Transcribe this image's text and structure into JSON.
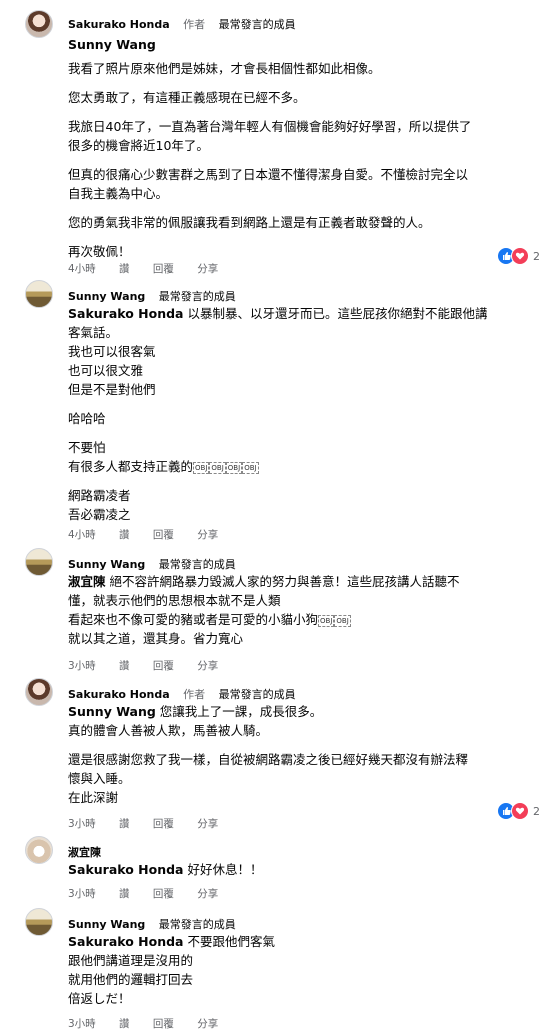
{
  "comments": [
    {
      "author": "Sakurako Honda",
      "badge_author": "作者",
      "badge_member": "最常發言的成員",
      "lines": [
        {
          "text": "Sunny Wang",
          "mention": true
        },
        {
          "text": "我看了照片原來他們是姊妹，才會長相個性都如此相像。"
        },
        {
          "text": "",
          "gap": true
        },
        {
          "text": "您太勇敢了，有這種正義感現在已經不多。"
        },
        {
          "text": "",
          "gap": true
        },
        {
          "text": "我旅日40年了，一直為著台灣年輕人有個機會能夠好好學習，所以提供了"
        },
        {
          "text": "很多的機會將近10年了。"
        },
        {
          "text": "",
          "gap": true
        },
        {
          "text": "但真的很痛心少數害群之馬到了日本還不懂得潔身自愛。不懂檢討完全以"
        },
        {
          "text": "自我主義為中心。"
        },
        {
          "text": "",
          "gap": true
        },
        {
          "text": "您的勇氣我非常的佩服讓我看到網路上還是有正義者敢發聲的人。"
        },
        {
          "text": "",
          "gap": true
        },
        {
          "text": "再次敬佩！"
        }
      ],
      "time": "4小時",
      "actions": [
        "讚",
        "回覆",
        "分享"
      ],
      "reaction_count": "2"
    },
    {
      "author": "Sunny Wang",
      "badge_member": "最常發言的成員",
      "lines": [
        {
          "mention_prefix": "Sakurako Honda",
          "text": " 以暴制暴、以牙還牙而已。這些屁孩你絕對不能跟他講"
        },
        {
          "text": "客氣話。"
        },
        {
          "text": "我也可以很客氣"
        },
        {
          "text": "也可以很文雅"
        },
        {
          "text": "但是不是對他們"
        },
        {
          "text": "",
          "gap": true
        },
        {
          "text": "哈哈哈"
        },
        {
          "text": "",
          "gap": true
        },
        {
          "text": "不要怕"
        },
        {
          "text": "有很多人都支持正義的",
          "emoji_count": 4
        },
        {
          "text": "",
          "gap": true
        },
        {
          "text": "網路霸凌者"
        },
        {
          "text": "吾必霸凌之"
        }
      ],
      "time": "4小時",
      "actions": [
        "讚",
        "回覆",
        "分享"
      ]
    },
    {
      "author": "Sunny Wang",
      "badge_member": "最常發言的成員",
      "lines": [
        {
          "mention_prefix": "淑宜陳",
          "text": " 絕不容許網路暴力毀滅人家的努力與善意！這些屁孩講人話聽不"
        },
        {
          "text": "懂，就表示他們的思想根本就不是人類"
        },
        {
          "text": "看起來也不像可愛的豬或者是可愛的小貓小狗",
          "emoji_count": 2
        },
        {
          "text": "就以其之道，還其身。省力寬心"
        }
      ],
      "time": "3小時",
      "actions": [
        "讚",
        "回覆",
        "分享"
      ]
    },
    {
      "author": "Sakurako Honda",
      "badge_author": "作者",
      "badge_member": "最常發言的成員",
      "lines": [
        {
          "mention_prefix": "Sunny Wang",
          "text": " 您讓我上了一課，成長很多。"
        },
        {
          "text": "真的體會人善被人欺，馬善被人騎。"
        },
        {
          "text": "",
          "gap": true
        },
        {
          "text": "還是很感謝您救了我一樣，自從被網路霸凌之後已經好幾天都沒有辦法釋"
        },
        {
          "text": "懷與入睡。"
        },
        {
          "text": "在此深謝"
        }
      ],
      "time": "3小時",
      "actions": [
        "讚",
        "回覆",
        "分享"
      ],
      "reaction_count": "2"
    },
    {
      "author": "淑宜陳",
      "lines": [
        {
          "mention_prefix": "Sakurako Honda",
          "text": " 好好休息！！"
        }
      ],
      "time": "3小時",
      "actions": [
        "讚",
        "回覆",
        "分享"
      ]
    },
    {
      "author": "Sunny Wang",
      "badge_member": "最常發言的成員",
      "lines": [
        {
          "mention_prefix": "Sakurako Honda",
          "text": " 不要跟他們客氣"
        },
        {
          "text": "跟他們講道理是沒用的"
        },
        {
          "text": "就用他們的邏輯打回去"
        },
        {
          "text": "倍返しだ！"
        }
      ],
      "time": "3小時",
      "actions": [
        "讚",
        "回覆",
        "分享"
      ]
    }
  ],
  "emoji_placeholder": "OBJ",
  "colors": {
    "like": "#1877f2",
    "love": "#f33e58",
    "meta": "#65676b"
  }
}
